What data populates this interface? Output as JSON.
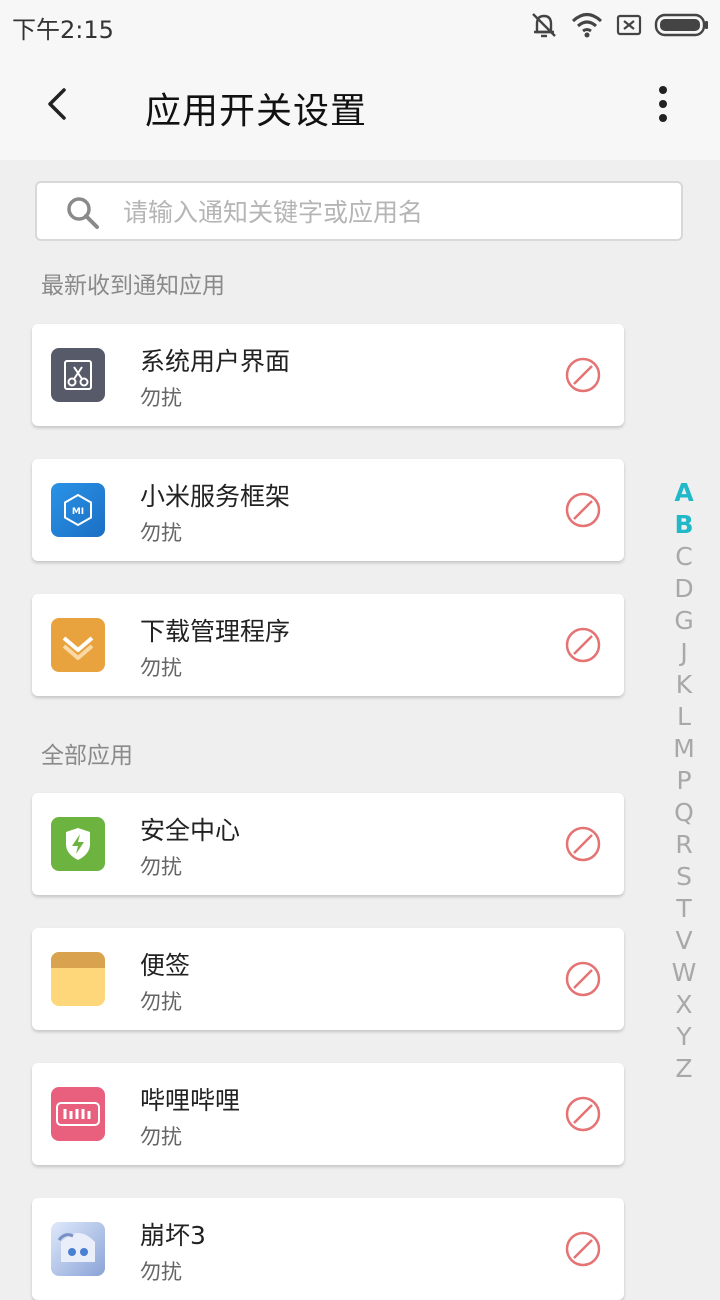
{
  "status_bar": {
    "time": "下午2:15",
    "icons": [
      "mute-icon",
      "wifi-icon",
      "sim-off-icon",
      "battery-icon"
    ]
  },
  "header": {
    "title": "应用开关设置",
    "back_icon": "back-arrow-icon",
    "more_icon": "more-vertical-icon"
  },
  "search": {
    "placeholder": "请输入通知关键字或应用名",
    "value": ""
  },
  "sections": {
    "recent_label": "最新收到通知应用",
    "all_label": "全部应用"
  },
  "recent_apps": [
    {
      "name": "系统用户界面",
      "status": "勿扰",
      "icon": "system-ui-icon",
      "color": "#565a69"
    },
    {
      "name": "小米服务框架",
      "status": "勿扰",
      "icon": "mi-service-icon",
      "color": "#1f7ed4"
    },
    {
      "name": "下载管理程序",
      "status": "勿扰",
      "icon": "download-manager-icon",
      "color": "#e9a33e"
    }
  ],
  "all_apps": [
    {
      "name": "安全中心",
      "status": "勿扰",
      "icon": "security-center-icon",
      "color": "#6db33f"
    },
    {
      "name": "便签",
      "status": "勿扰",
      "icon": "notes-icon",
      "color": "#fdd77a"
    },
    {
      "name": "哔哩哔哩",
      "status": "勿扰",
      "icon": "bilibili-icon",
      "color": "#e8607e"
    },
    {
      "name": "崩坏3",
      "status": "勿扰",
      "icon": "honkai-icon",
      "color": "#c9d6f0"
    }
  ],
  "alphabet_index": {
    "letters": [
      "A",
      "B",
      "C",
      "D",
      "G",
      "J",
      "K",
      "L",
      "M",
      "P",
      "Q",
      "R",
      "S",
      "T",
      "V",
      "W",
      "X",
      "Y",
      "Z"
    ],
    "active": [
      "A",
      "B"
    ],
    "active_color": "#21b8c8"
  },
  "dnd_icon": "do-not-disturb-icon",
  "accent_colors": {
    "dnd": "#e57373"
  }
}
